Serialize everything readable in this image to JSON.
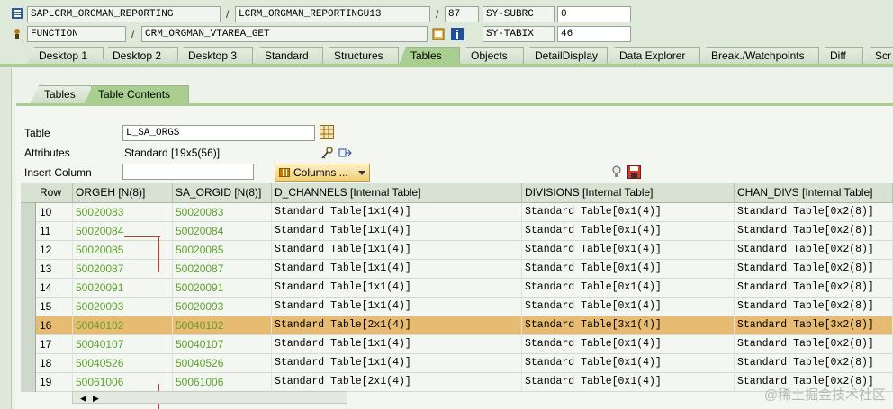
{
  "header": {
    "program": "SAPLCRM_ORGMAN_REPORTING",
    "include": "LCRM_ORGMAN_REPORTINGU13",
    "line": "87",
    "subrc_label": "SY-SUBRC",
    "subrc_value": "0",
    "event_type": "FUNCTION",
    "event_name": "CRM_ORGMAN_VTAREA_GET",
    "tabix_label": "SY-TABIX",
    "tabix_value": "46",
    "separator": "/"
  },
  "main_tabs": [
    {
      "label": "Desktop 1"
    },
    {
      "label": "Desktop 2"
    },
    {
      "label": "Desktop 3"
    },
    {
      "label": "Standard"
    },
    {
      "label": "Structures"
    },
    {
      "label": "Tables",
      "active": true
    },
    {
      "label": "Objects"
    },
    {
      "label": "DetailDisplay"
    },
    {
      "label": "Data Explorer"
    },
    {
      "label": "Break./Watchpoints"
    },
    {
      "label": "Diff"
    },
    {
      "label": "Scr"
    }
  ],
  "sub_tabs": [
    {
      "label": "Tables"
    },
    {
      "label": "Table Contents",
      "active": true
    }
  ],
  "form": {
    "table_label": "Table",
    "table_value": "L_SA_ORGS",
    "attributes_label": "Attributes",
    "attributes_value": "Standard [19x5(56)]",
    "insert_column_label": "Insert Column",
    "columns_button": "Columns ..."
  },
  "grid": {
    "headers": [
      "Row",
      "ORGEH [N(8)]",
      "SA_ORGID [N(8)]",
      "D_CHANNELS [Internal Table]",
      "DIVISIONS [Internal Table]",
      "CHAN_DIVS [Internal Table]"
    ],
    "rows": [
      {
        "row": "10",
        "orgeh": "50020083",
        "sa_orgid": "50020083",
        "d_channels": "Standard Table[1x1(4)]",
        "divisions": "Standard Table[0x1(4)]",
        "chan_divs": "Standard Table[0x2(8)]"
      },
      {
        "row": "11",
        "orgeh": "50020084",
        "sa_orgid": "50020084",
        "d_channels": "Standard Table[1x1(4)]",
        "divisions": "Standard Table[0x1(4)]",
        "chan_divs": "Standard Table[0x2(8)]"
      },
      {
        "row": "12",
        "orgeh": "50020085",
        "sa_orgid": "50020085",
        "d_channels": "Standard Table[1x1(4)]",
        "divisions": "Standard Table[0x1(4)]",
        "chan_divs": "Standard Table[0x2(8)]"
      },
      {
        "row": "13",
        "orgeh": "50020087",
        "sa_orgid": "50020087",
        "d_channels": "Standard Table[1x1(4)]",
        "divisions": "Standard Table[0x1(4)]",
        "chan_divs": "Standard Table[0x2(8)]"
      },
      {
        "row": "14",
        "orgeh": "50020091",
        "sa_orgid": "50020091",
        "d_channels": "Standard Table[1x1(4)]",
        "divisions": "Standard Table[0x1(4)]",
        "chan_divs": "Standard Table[0x2(8)]"
      },
      {
        "row": "15",
        "orgeh": "50020093",
        "sa_orgid": "50020093",
        "d_channels": "Standard Table[1x1(4)]",
        "divisions": "Standard Table[0x1(4)]",
        "chan_divs": "Standard Table[0x2(8)]"
      },
      {
        "row": "16",
        "orgeh": "50040102",
        "sa_orgid": "50040102",
        "d_channels": "Standard Table[2x1(4)]",
        "divisions": "Standard Table[3x1(4)]",
        "chan_divs": "Standard Table[3x2(8)]",
        "highlight": true
      },
      {
        "row": "17",
        "orgeh": "50040107",
        "sa_orgid": "50040107",
        "d_channels": "Standard Table[1x1(4)]",
        "divisions": "Standard Table[0x1(4)]",
        "chan_divs": "Standard Table[0x2(8)]"
      },
      {
        "row": "18",
        "orgeh": "50040526",
        "sa_orgid": "50040526",
        "d_channels": "Standard Table[1x1(4)]",
        "divisions": "Standard Table[0x1(4)]",
        "chan_divs": "Standard Table[0x2(8)]"
      },
      {
        "row": "19",
        "orgeh": "50061006",
        "sa_orgid": "50061006",
        "d_channels": "Standard Table[2x1(4)]",
        "divisions": "Standard Table[0x1(4)]",
        "chan_divs": "Standard Table[0x2(8)]"
      }
    ]
  },
  "watermark": "@稀土掘金技术社区",
  "colors": {
    "active_tab": "#a8cf8f",
    "key_text": "#5da22e",
    "highlight_row": "#e7bc72"
  }
}
